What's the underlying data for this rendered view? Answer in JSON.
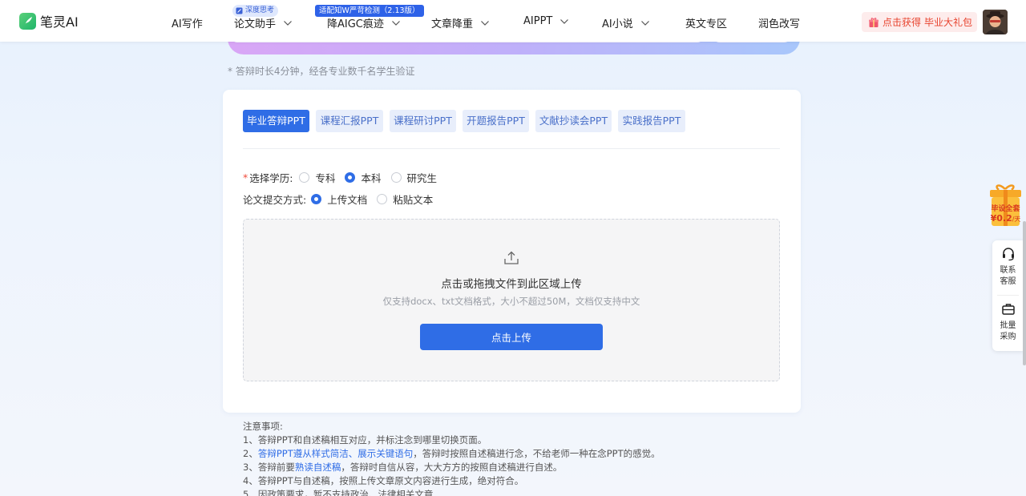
{
  "header": {
    "logo_text": "笔灵AI",
    "nav": [
      {
        "label": "AI写作"
      },
      {
        "label": "论文助手",
        "badge": "深度思考"
      },
      {
        "label": "降AIGC痕迹",
        "badge": "适配知W严苛检测（2.13版）"
      },
      {
        "label": "文章降重"
      },
      {
        "label": "AIPPT"
      },
      {
        "label": "AI小说"
      },
      {
        "label": "英文专区"
      },
      {
        "label": "润色改写"
      }
    ],
    "gift_prefix": "点击获得",
    "gift_highlight": "毕业大礼包"
  },
  "subnote": "* 答辩时长4分钟，经各专业数千名学生验证",
  "tabs": [
    "毕业答辩PPT",
    "课程汇报PPT",
    "课程研讨PPT",
    "开题报告PPT",
    "文献抄读会PPT",
    "实践报告PPT"
  ],
  "form": {
    "education_label": "选择学历:",
    "education_options": [
      "专科",
      "本科",
      "研究生"
    ],
    "education_selected": "本科",
    "submit_label": "论文提交方式:",
    "submit_options": [
      "上传文档",
      "粘贴文本"
    ],
    "submit_selected": "上传文档"
  },
  "upload": {
    "title": "点击或拖拽文件到此区域上传",
    "hint": "仅支持docx、txt文档格式，大小不超过50M，文档仅支持中文",
    "button": "点击上传"
  },
  "notes": {
    "heading": "注意事项:",
    "items": [
      {
        "pre": "1、答辩PPT和自述稿相互对应，并标注念到哪里切换页面。",
        "hl": "",
        "post": ""
      },
      {
        "pre": "2、",
        "hl": "答辩PPT遵从样式简洁、展示关键语句",
        "post": "，答辩时按照自述稿进行念，不给老师一种在念PPT的感觉。"
      },
      {
        "pre": "3、答辩前要",
        "hl": "熟读自述稿",
        "post": "，答辩时自信从容，大大方方的按照自述稿进行自述。"
      },
      {
        "pre": "4、答辩PPT与自述稿，按照上传文章原文内容进行生成，绝对符合。",
        "hl": "",
        "post": ""
      },
      {
        "pre": "5、因政策要求，暂不支持政治、法律相关文章",
        "hl": "",
        "post": ""
      }
    ]
  },
  "promo": {
    "line1": "毕设全套",
    "price": "¥0.2",
    "unit": "/天"
  },
  "side": {
    "contact": "联系客服",
    "bulk": "批量采购"
  },
  "colors": {
    "primary": "#2f6de6",
    "required": "#f04b3b",
    "gift": "#e8432e"
  }
}
